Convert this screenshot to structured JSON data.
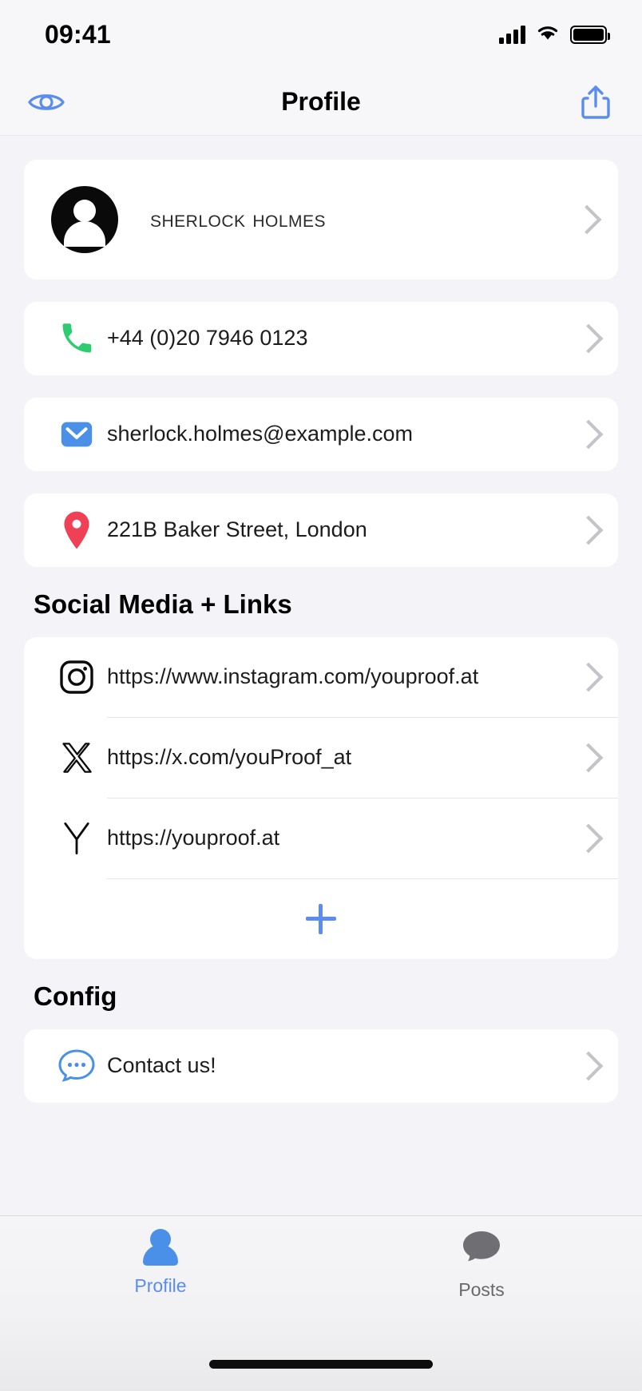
{
  "status_bar": {
    "time": "09:41",
    "cellular_icon": "cellular-signal-icon",
    "wifi_icon": "wifi-icon",
    "battery_icon": "battery-full-icon"
  },
  "header": {
    "title": "Profile",
    "left_icon": "eye-icon",
    "right_icon": "share-icon",
    "accent_color": "#5b8def"
  },
  "profile": {
    "name": "Sherlock Holmes",
    "avatar_icon": "person-avatar-icon",
    "chevron": "chevron-right-icon"
  },
  "contact_rows": [
    {
      "icon": "phone-icon",
      "icon_color": "#2ecc71",
      "value": "+44 (0)20 7946 0123"
    },
    {
      "icon": "email-icon",
      "icon_color": "#4a90e8",
      "value": "sherlock.holmes@example.com"
    },
    {
      "icon": "location-pin-icon",
      "icon_color": "#ef4055",
      "value": "221B Baker Street, London"
    }
  ],
  "social": {
    "section_title": "Social Media + Links",
    "links": [
      {
        "icon": "instagram-icon",
        "url": "https://www.instagram.com/youproof.at"
      },
      {
        "icon": "x-twitter-icon",
        "url": "https://x.com/youProof_at"
      },
      {
        "icon": "youproof-y-icon",
        "url": "https://youproof.at"
      }
    ],
    "add_label": "+",
    "add_icon": "plus-icon"
  },
  "config": {
    "section_title": "Config",
    "items": [
      {
        "icon": "chat-bubble-icon",
        "label": "Contact us!"
      }
    ]
  },
  "tabbar": {
    "tabs": [
      {
        "label": "Profile",
        "icon": "person-icon",
        "active": true
      },
      {
        "label": "Posts",
        "icon": "chat-bubble-filled-icon",
        "active": false
      }
    ],
    "active_color": "#5b8def",
    "inactive_color": "#68686d"
  }
}
